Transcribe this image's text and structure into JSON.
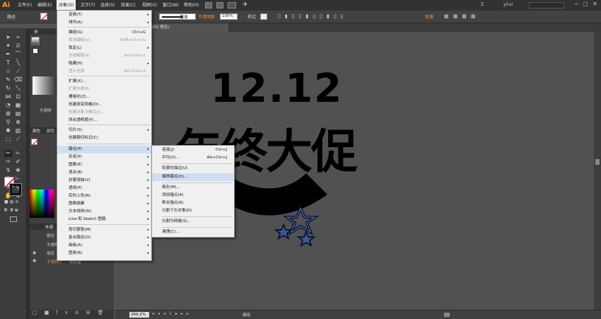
{
  "menubar": {
    "logo": "Ai",
    "items": [
      "文件(F)",
      "编辑(E)",
      "对象(O)",
      "文字(T)",
      "选择(S)",
      "效果(C)",
      "视图(V)",
      "窗口(W)",
      "帮助(H)"
    ],
    "user": "yirui",
    "user_initial": "Z"
  },
  "controlbar": {
    "path_label": "路径",
    "stroke_basic": "基本",
    "opacity_label": "不透明度",
    "opacity_value": "100%",
    "style_label": "样式",
    "transform_label": "变换"
  },
  "document": {
    "tab_title": "@ 269.2% (RGB/GPU 预览)",
    "zoom": "269.2%",
    "status_text": "编组"
  },
  "artwork": {
    "title_line1": "12.12",
    "title_line2": "年终大促"
  },
  "panels": {
    "color_tab": "颜色",
    "appearance_tab": "外观",
    "path_label": "路径",
    "transparent_label": "不透明",
    "fill_label": "填色",
    "opacity_label": "不透明度",
    "default_label": "默认值",
    "panel_label_a": "美",
    "panel_label_b": "颜色"
  },
  "object_menu": {
    "items": [
      {
        "label": "变换(T)",
        "shortcut": "",
        "submenu": true,
        "disabled": false
      },
      {
        "label": "排列(A)",
        "shortcut": "",
        "submenu": true,
        "disabled": false
      },
      {
        "label": "编组(G)",
        "shortcut": "Ctrl+G",
        "submenu": false,
        "disabled": false
      },
      {
        "label": "取消编组(U)",
        "shortcut": "Shift+Ctrl+G",
        "submenu": false,
        "disabled": true
      },
      {
        "label": "锁定(L)",
        "shortcut": "",
        "submenu": true,
        "disabled": false
      },
      {
        "label": "全部解锁(K)",
        "shortcut": "Alt+Ctrl+2",
        "submenu": false,
        "disabled": true
      },
      {
        "label": "隐藏(H)",
        "shortcut": "",
        "submenu": true,
        "disabled": false
      },
      {
        "label": "显示全部",
        "shortcut": "Alt+Ctrl+3",
        "submenu": false,
        "disabled": true
      },
      {
        "label": "扩展(X)...",
        "shortcut": "",
        "submenu": false,
        "disabled": false
      },
      {
        "label": "扩展外观(E)",
        "shortcut": "",
        "submenu": false,
        "disabled": true
      },
      {
        "label": "栅格化(Z)...",
        "shortcut": "",
        "submenu": false,
        "disabled": false
      },
      {
        "label": "创建渐变网格(D)...",
        "shortcut": "",
        "submenu": false,
        "disabled": false
      },
      {
        "label": "创建对象马赛克(J)...",
        "shortcut": "",
        "submenu": false,
        "disabled": true
      },
      {
        "label": "拼合透明度(F)...",
        "shortcut": "",
        "submenu": false,
        "disabled": false
      },
      {
        "label": "切片(S)",
        "shortcut": "",
        "submenu": true,
        "disabled": false
      },
      {
        "label": "创建裁切标记(C)",
        "shortcut": "",
        "submenu": false,
        "disabled": false
      },
      {
        "label": "路径(P)",
        "shortcut": "",
        "submenu": true,
        "disabled": false
      },
      {
        "label": "形状(P)",
        "shortcut": "",
        "submenu": true,
        "disabled": false
      },
      {
        "label": "图案(E)",
        "shortcut": "",
        "submenu": true,
        "disabled": false
      },
      {
        "label": "混合(B)",
        "shortcut": "",
        "submenu": true,
        "disabled": false
      },
      {
        "label": "封套扭曲(V)",
        "shortcut": "",
        "submenu": true,
        "disabled": false
      },
      {
        "label": "透视(P)",
        "shortcut": "",
        "submenu": true,
        "disabled": false
      },
      {
        "label": "实时上色(N)",
        "shortcut": "",
        "submenu": true,
        "disabled": false
      },
      {
        "label": "图像描摹",
        "shortcut": "",
        "submenu": true,
        "disabled": false
      },
      {
        "label": "文本绕排(W)",
        "shortcut": "",
        "submenu": true,
        "disabled": false
      },
      {
        "label": "Line 和 Sketch 图稿",
        "shortcut": "",
        "submenu": true,
        "disabled": false
      },
      {
        "label": "剪切蒙版(M)",
        "shortcut": "",
        "submenu": true,
        "disabled": false
      },
      {
        "label": "复合路径(O)",
        "shortcut": "",
        "submenu": true,
        "disabled": false
      },
      {
        "label": "画板(A)",
        "shortcut": "",
        "submenu": true,
        "disabled": false
      },
      {
        "label": "图表(R)",
        "shortcut": "",
        "submenu": true,
        "disabled": false
      }
    ]
  },
  "path_submenu": {
    "items": [
      {
        "label": "连接(J)",
        "shortcut": "Ctrl+J"
      },
      {
        "label": "平均(V)...",
        "shortcut": "Alt+Ctrl+J"
      },
      {
        "label": "轮廓化描边(U)",
        "shortcut": ""
      },
      {
        "label": "偏移路径(O)...",
        "shortcut": ""
      },
      {
        "label": "简化(M)...",
        "shortcut": ""
      },
      {
        "label": "添加锚点(A)",
        "shortcut": ""
      },
      {
        "label": "移去锚点(R)",
        "shortcut": ""
      },
      {
        "label": "分割下方对象(D)",
        "shortcut": ""
      },
      {
        "label": "分割为网格(S)...",
        "shortcut": ""
      },
      {
        "label": "清理(C)...",
        "shortcut": ""
      }
    ]
  }
}
